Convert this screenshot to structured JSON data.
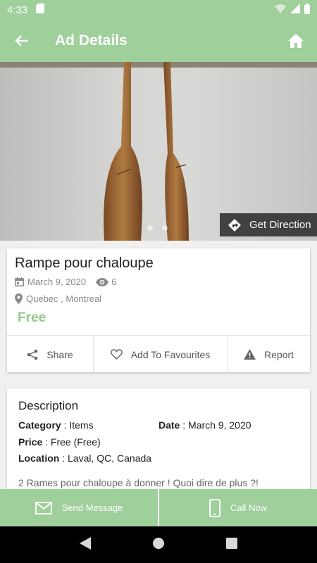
{
  "status_bar": {
    "time": "4:33"
  },
  "app_bar": {
    "title": "Ad Details"
  },
  "photo": {
    "direction_label": "Get Direction",
    "page_count": 2
  },
  "ad": {
    "title": "Rampe pour chaloupe",
    "date": "March 9, 2020",
    "views": "6",
    "location": "Quebec , Montreal",
    "price": "Free"
  },
  "actions": {
    "share": "Share",
    "favourites": "Add To Favourites",
    "report": "Report"
  },
  "description": {
    "heading": "Description",
    "category_label": "Category",
    "category_value": " : Items",
    "date_label": "Date",
    "date_value": " : March 9, 2020",
    "price_label": "Price",
    "price_value": " : Free (Free)",
    "location_label": "Location",
    "location_value": " : Laval, QC, Canada",
    "text": "2 Rames pour chaloupe à donner ! Quoi dire de plus ?!"
  },
  "bottom_bar": {
    "send_message": "Send Message",
    "call_now": "Call Now"
  },
  "colors": {
    "accent": "#9fcf9b",
    "price": "#8fcb86"
  },
  "icons": [
    "sd-card-icon",
    "wifi-icon",
    "signal-icon",
    "battery-icon",
    "back-arrow-icon",
    "home-icon",
    "directions-icon",
    "calendar-icon",
    "eye-icon",
    "location-pin-icon",
    "share-icon",
    "heart-icon",
    "warning-icon",
    "mail-icon",
    "phone-icon",
    "nav-back-icon",
    "nav-home-icon",
    "nav-recents-icon"
  ]
}
